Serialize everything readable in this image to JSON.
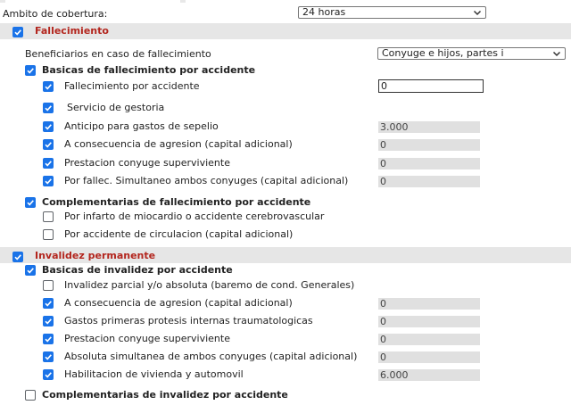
{
  "cobertura": {
    "label": "Ambito de cobertura:",
    "value": "24 horas"
  },
  "fallecimiento": {
    "title": "Fallecimiento",
    "beneficiarios_label": "Beneficiarios en caso de fallecimiento",
    "beneficiarios_value": "Conyuge e hijos, partes i",
    "basicas": {
      "title": "Basicas de fallecimiento por accidente",
      "items": [
        {
          "label": "Fallecimiento por accidente",
          "value": "0",
          "checked": true
        },
        {
          "label": "Servicio de gestoria",
          "value": "",
          "checked": true
        },
        {
          "label": "Anticipo para gastos de sepelio",
          "value": "3.000",
          "checked": true
        },
        {
          "label": "A consecuencia de agresion (capital adicional)",
          "value": "0",
          "checked": true
        },
        {
          "label": "Prestacion conyuge superviviente",
          "value": "0",
          "checked": true
        },
        {
          "label": "Por fallec. Simultaneo ambos conyuges (capital adicional)",
          "value": "0",
          "checked": true
        }
      ]
    },
    "complementarias": {
      "title": "Complementarias de fallecimiento por accidente",
      "items": [
        {
          "label": "Por infarto de miocardio o accidente cerebrovascular",
          "checked": false
        },
        {
          "label": "Por accidente de circulacion (capital adicional)",
          "checked": false
        }
      ]
    }
  },
  "invalidez": {
    "title": "Invalidez permanente",
    "basicas": {
      "title": "Basicas de invalidez por accidente",
      "items": [
        {
          "label": "Invalidez parcial y/o absoluta (baremo de cond. Generales)",
          "value": "",
          "checked": false
        },
        {
          "label": "A consecuencia de agresion (capital adicional)",
          "value": "0",
          "checked": true
        },
        {
          "label": "Gastos primeras protesis internas traumatologicas",
          "value": "0",
          "checked": true
        },
        {
          "label": "Prestacion conyuge superviviente",
          "value": "0",
          "checked": true
        },
        {
          "label": "Absoluta simultanea de ambos conyuges (capital adicional)",
          "value": "0",
          "checked": true
        },
        {
          "label": "Habilitacion de vivienda y automovil",
          "value": "6.000",
          "checked": true
        }
      ]
    },
    "complementarias": {
      "title": "Complementarias de invalidez por accidente",
      "checked": false
    }
  },
  "colors": {
    "accent": "#1a73e8",
    "section_title": "#b3261e",
    "section_bg": "#e6e6e6",
    "readonly_bg": "#e0e0e0"
  },
  "icons": {
    "checkbox_checked": "check-icon",
    "dropdown": "chevron-down-icon"
  }
}
